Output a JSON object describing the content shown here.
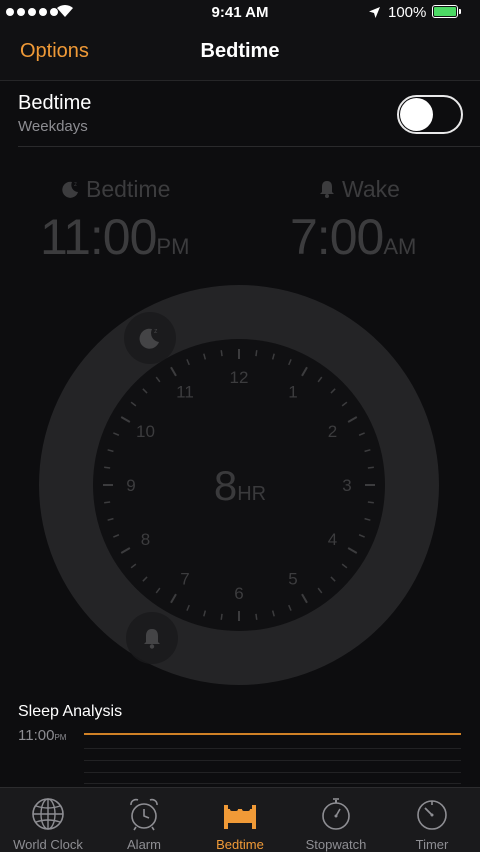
{
  "status_bar": {
    "time": "9:41 AM",
    "battery": "100%"
  },
  "nav": {
    "left": "Options",
    "title": "Bedtime"
  },
  "bedtime_row": {
    "title": "Bedtime",
    "subtitle": "Weekdays",
    "enabled": false
  },
  "bedtime": {
    "label": "Bedtime",
    "time": "11:00",
    "ampm": "PM",
    "icon": "moon-icon"
  },
  "wake": {
    "label": "Wake",
    "time": "7:00",
    "ampm": "AM",
    "icon": "bell-icon"
  },
  "dial": {
    "hours": "8",
    "unit": "HR",
    "numbers": [
      "12",
      "1",
      "2",
      "3",
      "4",
      "5",
      "6",
      "7",
      "8",
      "9",
      "10",
      "11"
    ]
  },
  "sleep_analysis": {
    "title": "Sleep Analysis",
    "start": "11:00",
    "start_suffix": "PM"
  },
  "tabs": [
    {
      "label": "World Clock",
      "icon": "globe-icon",
      "active": false
    },
    {
      "label": "Alarm",
      "icon": "alarm-clock-icon",
      "active": false
    },
    {
      "label": "Bedtime",
      "icon": "bed-icon",
      "active": true
    },
    {
      "label": "Stopwatch",
      "icon": "stopwatch-icon",
      "active": false
    },
    {
      "label": "Timer",
      "icon": "timer-icon",
      "active": false
    }
  ],
  "colors": {
    "accent": "#f09a37",
    "battery": "#4cd964",
    "sleep_bar": "#d08126"
  }
}
